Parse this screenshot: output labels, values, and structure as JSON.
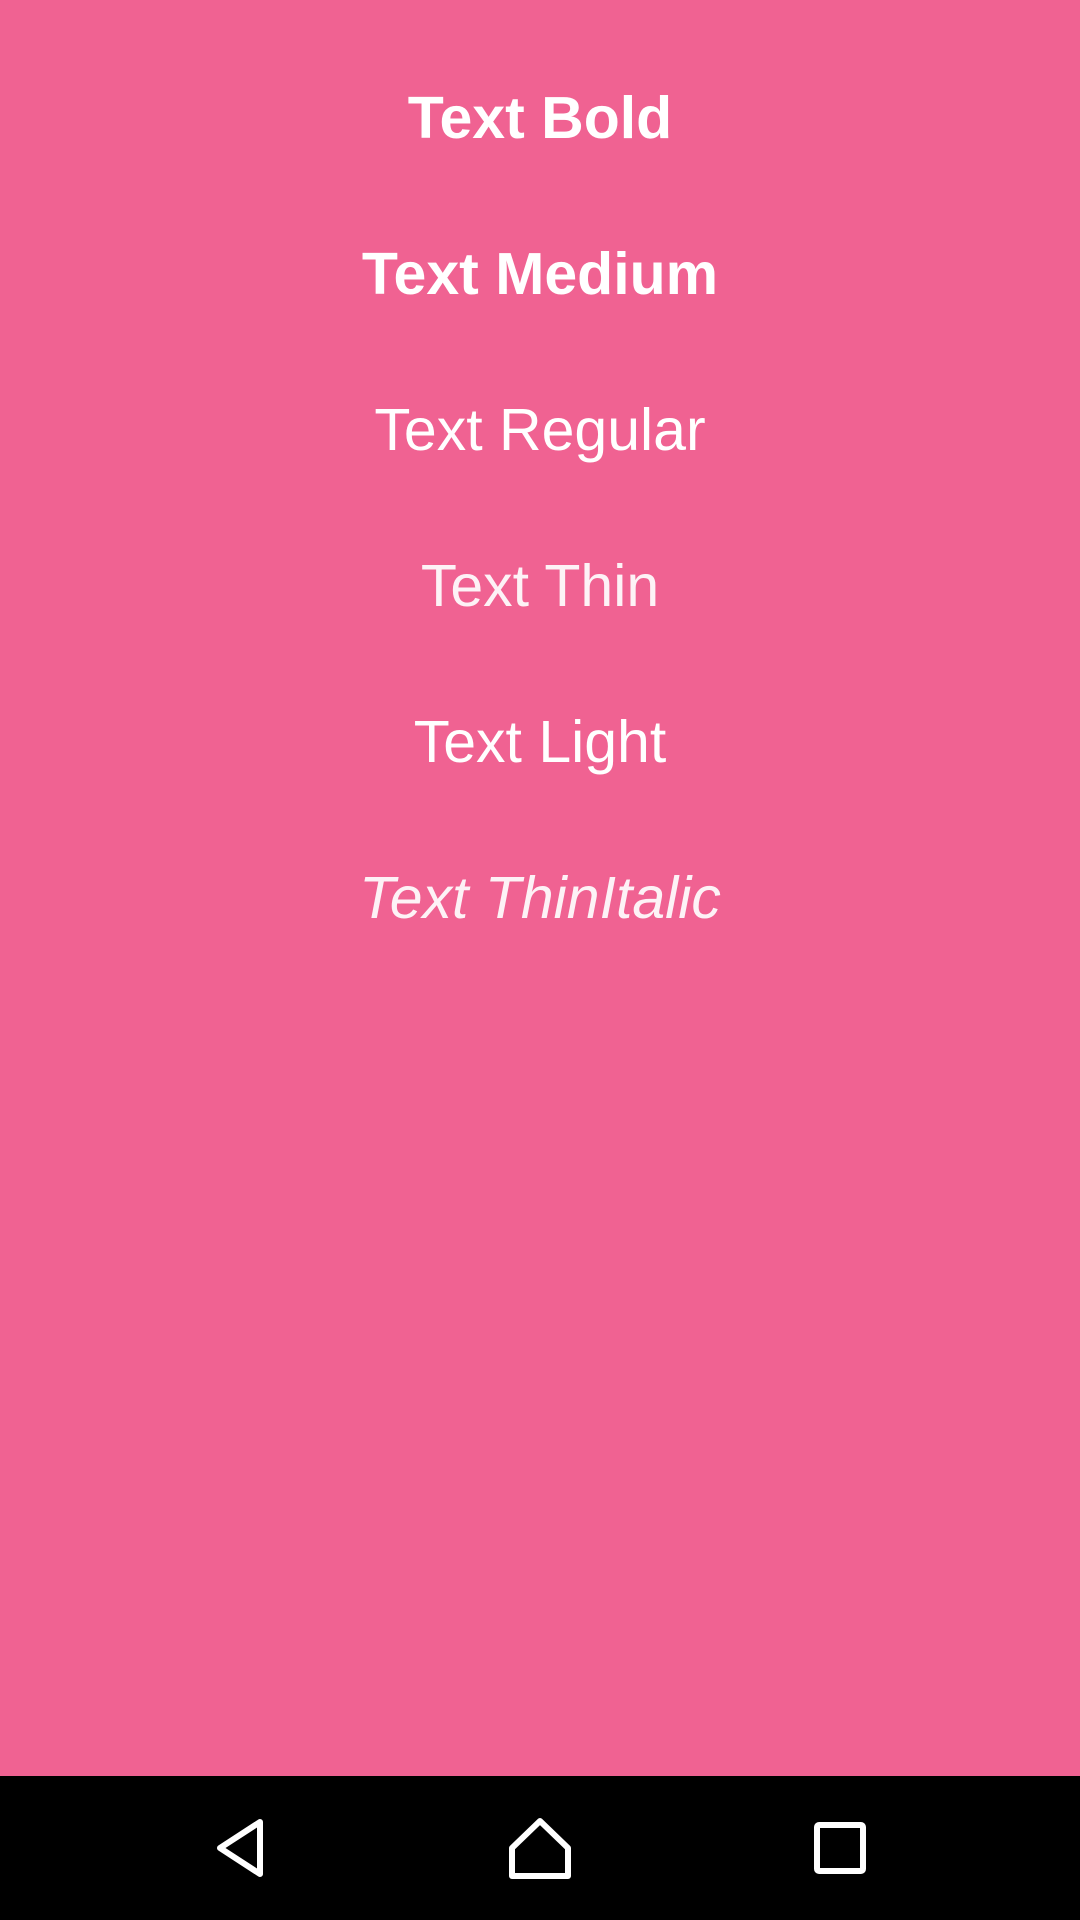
{
  "screen": {
    "background_color": "#F06292",
    "text_color": "#FFFFFF"
  },
  "labels": {
    "bold": "Text Bold",
    "medium": "Text Medium",
    "regular": "Text Regular",
    "thin": "Text Thin",
    "light": "Text Light",
    "thin_italic": "Text ThinItalic"
  },
  "navbar": {
    "background_color": "#000000",
    "icon_color": "#FFFFFF",
    "buttons": [
      {
        "icon": "back-triangle-icon"
      },
      {
        "icon": "home-icon"
      },
      {
        "icon": "recents-square-icon"
      }
    ]
  }
}
